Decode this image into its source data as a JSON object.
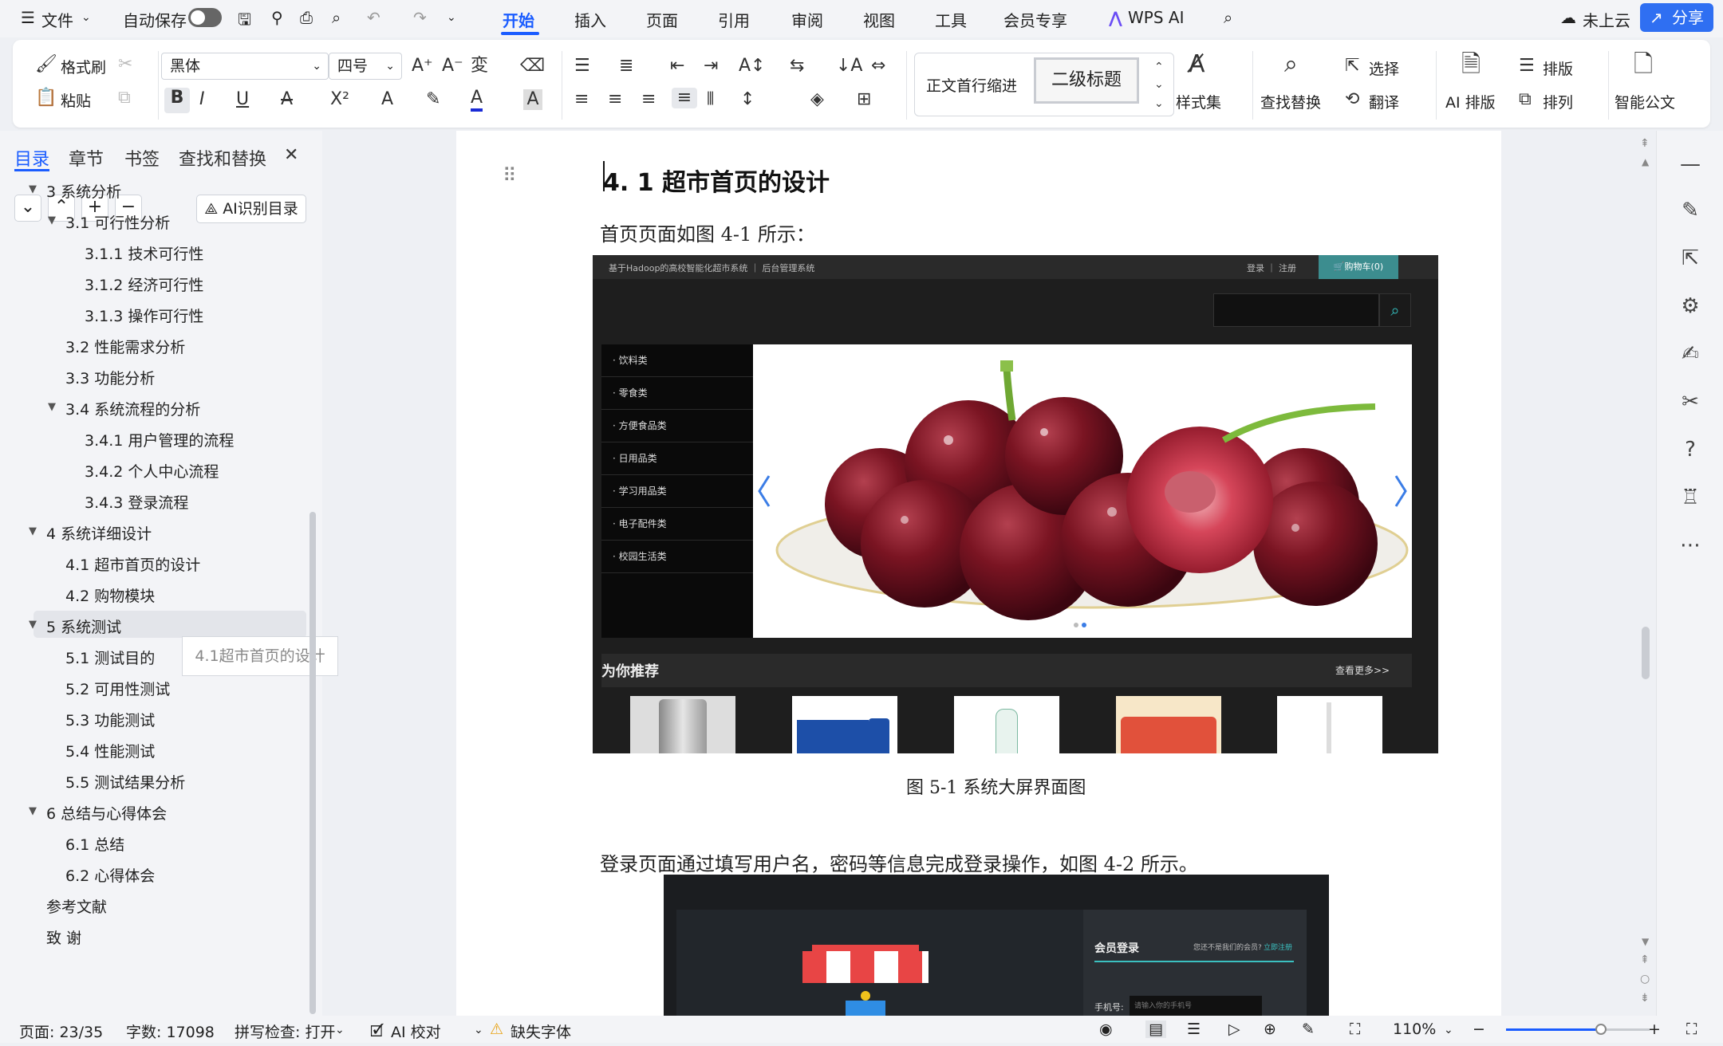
{
  "menu": {
    "file": "文件",
    "autosave": "自动保存",
    "tabs": [
      "开始",
      "插入",
      "页面",
      "引用",
      "审阅",
      "视图",
      "工具",
      "会员专享",
      "WPS AI"
    ],
    "cloud": "未上云",
    "share": "分享"
  },
  "ribbon": {
    "format_painter": "格式刷",
    "paste": "粘贴",
    "font": "黑体",
    "font_size": "四号",
    "style_normal": "正文首行缩进",
    "style_heading2": "二级标题",
    "styles": "样式集",
    "find_replace": "查找替换",
    "select": "选择",
    "translate": "翻译",
    "ai_layout": "AI 排版",
    "layout": "排版",
    "arrange": "排列",
    "smart_doc": "智能公文"
  },
  "sidebar": {
    "tabs": [
      "目录",
      "章节",
      "书签",
      "查找和替换"
    ],
    "ai_toc": "AI识别目录",
    "toc": [
      {
        "label": "3 系统分析",
        "level": 1,
        "expanded": true
      },
      {
        "label": "3.1 可行性分析",
        "level": 2,
        "expanded": true
      },
      {
        "label": "3.1.1 技术可行性",
        "level": 3
      },
      {
        "label": "3.1.2 经济可行性",
        "level": 3
      },
      {
        "label": "3.1.3 操作可行性",
        "level": 3
      },
      {
        "label": "3.2 性能需求分析",
        "level": 2
      },
      {
        "label": "3.3 功能分析",
        "level": 2
      },
      {
        "label": "3.4 系统流程的分析",
        "level": 2,
        "expanded": true
      },
      {
        "label": "3.4.1  用户管理的流程",
        "level": 3
      },
      {
        "label": "3.4.2  个人中心流程",
        "level": 3
      },
      {
        "label": "3.4.3  登录流程",
        "level": 3
      },
      {
        "label": "4 系统详细设计",
        "level": 1,
        "expanded": true
      },
      {
        "label": "4.1 超市首页的设计",
        "level": 2,
        "selected": true
      },
      {
        "label": "4.2 购物模块",
        "level": 2
      },
      {
        "label": "5 系统测试",
        "level": 1,
        "expanded": true
      },
      {
        "label": "5.1 测试目的",
        "level": 2
      },
      {
        "label": "5.2 可用性测试",
        "level": 2
      },
      {
        "label": "5.3 功能测试",
        "level": 2
      },
      {
        "label": "5.4 性能测试",
        "level": 2
      },
      {
        "label": "5.5 测试结果分析",
        "level": 2
      },
      {
        "label": "6 总结与心得体会",
        "level": 1,
        "expanded": true
      },
      {
        "label": "6.1  总结",
        "level": 2
      },
      {
        "label": "6.2  心得体会",
        "level": 2
      },
      {
        "label": "参考文献",
        "level": 1
      },
      {
        "label": "致  谢",
        "level": 1
      }
    ],
    "tooltip": "4.1超市首页的设计"
  },
  "doc": {
    "heading": "4. 1 超市首页的设计",
    "para1": "首页页面如图 4-1 所示：",
    "fig1": {
      "topbar_title": "基于Hadoop的高校智能化超市系统 ｜ 后台管理系统",
      "login": "登录 ｜ 注册",
      "cart": "购物车(0)",
      "categories": [
        "· 饮料类",
        "· 零食类",
        "· 方便食品类",
        "· 日用品类",
        "· 学习用品类",
        "· 电子配件类",
        "· 校园生活类"
      ],
      "recommend": "为你推荐",
      "more": "查看更多>>"
    },
    "caption1": "图 5-1 系统大屏界面图",
    "para2": "登录页面通过填写用户名，密码等信息完成登录操作，如图 4-2 所示。",
    "fig2": {
      "login_title": "会员登录",
      "register_prompt": "您还不是我们的会员?",
      "register_link": "立即注册",
      "phone_label": "手机号:",
      "phone_placeholder": "请输入你的手机号"
    }
  },
  "status": {
    "page": "页面: 23/35",
    "words": "字数: 17098",
    "spell": "拼写检查: 打开",
    "ai_check": "AI 校对",
    "missing_font": "缺失字体",
    "zoom": "110%"
  }
}
